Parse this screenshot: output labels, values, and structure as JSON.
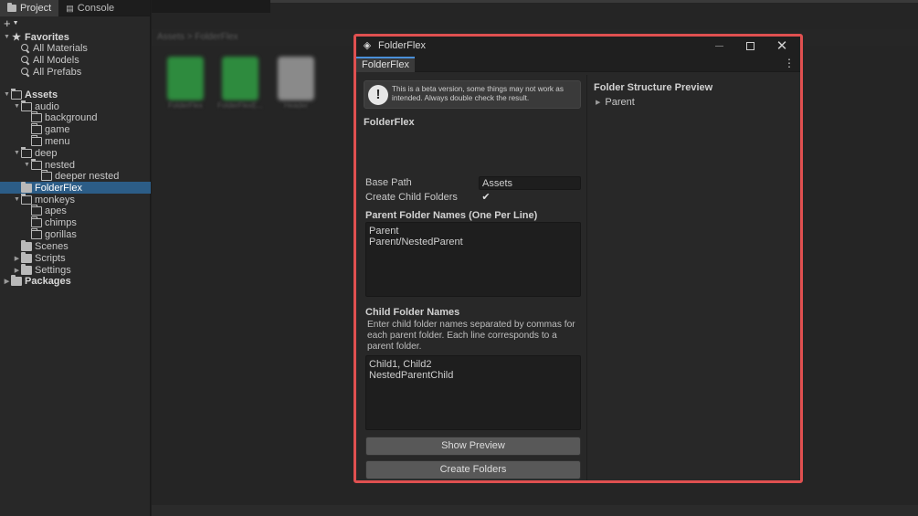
{
  "left_panel": {
    "tabs": [
      {
        "label": "Project",
        "active": true,
        "icon": "folder-icon"
      },
      {
        "label": "Console",
        "active": false,
        "icon": "console-icon"
      }
    ],
    "add_button": "+",
    "tree": [
      {
        "label": "Favorites",
        "indent": 0,
        "arrow": "down",
        "icon": "star-icon",
        "section": true
      },
      {
        "label": "All Materials",
        "indent": 1,
        "icon": "search-icon"
      },
      {
        "label": "All Models",
        "indent": 1,
        "icon": "search-icon"
      },
      {
        "label": "All Prefabs",
        "indent": 1,
        "icon": "search-icon"
      },
      {
        "label": "Assets",
        "indent": 0,
        "arrow": "down",
        "icon": "folder-open-icon",
        "section": true
      },
      {
        "label": "audio",
        "indent": 1,
        "arrow": "down",
        "icon": "folder-open-icon"
      },
      {
        "label": "background",
        "indent": 2,
        "icon": "folder-empty-icon"
      },
      {
        "label": "game",
        "indent": 2,
        "icon": "folder-empty-icon"
      },
      {
        "label": "menu",
        "indent": 2,
        "icon": "folder-empty-icon"
      },
      {
        "label": "deep",
        "indent": 1,
        "arrow": "down",
        "icon": "folder-open-icon"
      },
      {
        "label": "nested",
        "indent": 2,
        "arrow": "down",
        "icon": "folder-open-icon"
      },
      {
        "label": "deeper nested",
        "indent": 3,
        "icon": "folder-empty-icon"
      },
      {
        "label": "FolderFlex",
        "indent": 1,
        "icon": "folder-closed-icon",
        "selected": true
      },
      {
        "label": "monkeys",
        "indent": 1,
        "arrow": "down",
        "icon": "folder-open-icon"
      },
      {
        "label": "apes",
        "indent": 2,
        "icon": "folder-empty-icon"
      },
      {
        "label": "chimps",
        "indent": 2,
        "icon": "folder-empty-icon"
      },
      {
        "label": "gorillas",
        "indent": 2,
        "icon": "folder-empty-icon"
      },
      {
        "label": "Scenes",
        "indent": 1,
        "icon": "folder-closed-icon"
      },
      {
        "label": "Scripts",
        "indent": 1,
        "arrow": "right",
        "icon": "folder-closed-icon"
      },
      {
        "label": "Settings",
        "indent": 1,
        "arrow": "right",
        "icon": "folder-closed-icon"
      },
      {
        "label": "Packages",
        "indent": 0,
        "arrow": "right",
        "icon": "folder-closed-icon",
        "section": true
      }
    ]
  },
  "background": {
    "breadcrumb": "Assets > FolderFlex",
    "assets": [
      {
        "label": "FolderFlex",
        "color": "#2e8b3e"
      },
      {
        "label": "FolderFlexE...",
        "color": "#2e8b3e"
      },
      {
        "label": "Header",
        "color": "#8a8a8a"
      }
    ]
  },
  "window": {
    "title": "FolderFlex",
    "tab_label": "FolderFlex",
    "beta_icon": "!",
    "beta_text": "This is a beta version, some things may not work as intended. Always double check the result.",
    "section_title": "FolderFlex",
    "base_path_label": "Base Path",
    "base_path_value": "Assets",
    "create_child_label": "Create Child Folders",
    "create_child_checked": true,
    "parent_heading": "Parent Folder Names (One Per Line)",
    "parent_lines": [
      "Parent",
      "Parent/NestedParent"
    ],
    "child_heading": "Child Folder Names",
    "child_description": "Enter child folder names separated by commas for each parent folder. Each line corresponds to a parent folder.",
    "child_lines": [
      "Child1, Child2",
      "NestedParentChild"
    ],
    "show_preview_label": "Show Preview",
    "create_folders_label": "Create Folders",
    "preview_title": "Folder Structure Preview",
    "preview_item": "Parent",
    "border_color": "#e05050"
  }
}
